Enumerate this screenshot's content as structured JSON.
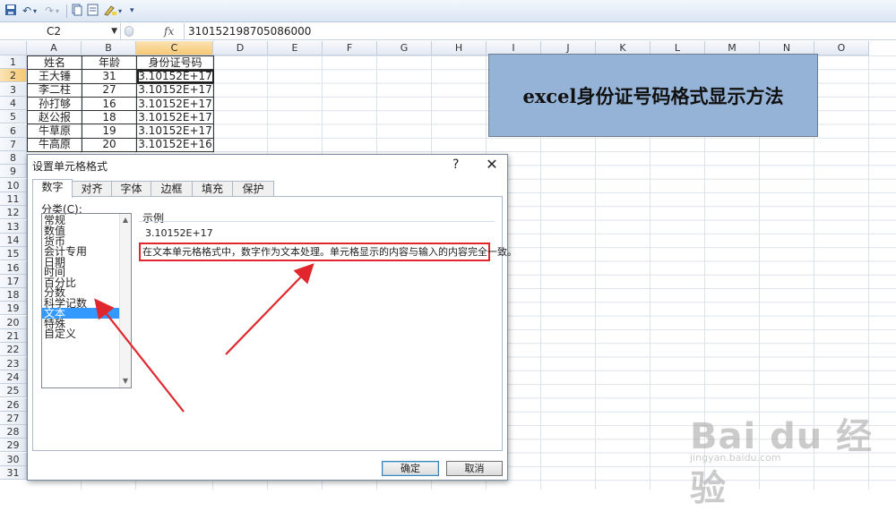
{
  "toolbar": {
    "items": [
      "save-icon",
      "undo-icon",
      "redo-icon",
      "copy-icon",
      "format-icon",
      "highlighter-icon",
      "customize-icon"
    ]
  },
  "formula_bar": {
    "name_box": "C2",
    "fx_label": "fx",
    "value": "310152198705086000"
  },
  "columns": [
    "A",
    "B",
    "C",
    "D",
    "E",
    "F",
    "G",
    "H",
    "I",
    "J",
    "K",
    "L",
    "M",
    "N",
    "O"
  ],
  "rows": [
    "1",
    "2",
    "3",
    "4",
    "5",
    "6",
    "7",
    "8",
    "9",
    "10",
    "11",
    "12",
    "13",
    "14",
    "15",
    "16",
    "17",
    "18",
    "19",
    "20",
    "21",
    "22",
    "23",
    "24",
    "25",
    "26",
    "27",
    "28",
    "29",
    "30",
    "31"
  ],
  "table": {
    "headers": [
      "姓名",
      "年龄",
      "身份证号码"
    ],
    "rows": [
      [
        "王大锤",
        "31",
        "3.10152E+17"
      ],
      [
        "李二柱",
        "27",
        "3.10152E+17"
      ],
      [
        "孙打够",
        "16",
        "3.10152E+17"
      ],
      [
        "赵公报",
        "18",
        "3.10152E+17"
      ],
      [
        "牛草原",
        "19",
        "3.10152E+17"
      ],
      [
        "牛高原",
        "20",
        "3.10152E+16"
      ]
    ]
  },
  "banner": {
    "text": "excel身份证号码格式显示方法",
    "color": "#95b3d7"
  },
  "dialog": {
    "title": "设置单元格格式",
    "help": "?",
    "close": "✕",
    "tabs": [
      "数字",
      "对齐",
      "字体",
      "边框",
      "填充",
      "保护"
    ],
    "active_tab": "数字",
    "category_label": "分类(C):",
    "categories": [
      "常规",
      "数值",
      "货币",
      "会计专用",
      "日期",
      "时间",
      "百分比",
      "分数",
      "科学记数",
      "文本",
      "特殊",
      "自定义"
    ],
    "selected_category": "文本",
    "sample_label": "示例",
    "sample_value": "3.10152E+17",
    "description": "在文本单元格格式中，数字作为文本处理。单元格显示的内容与输入的内容完全一致。",
    "ok_label": "确定",
    "cancel_label": "取消"
  },
  "annotation": {
    "highlight_color": "#e0272d"
  },
  "watermark": {
    "text": "Bai du 经验",
    "url": "jingyan.baidu.com"
  }
}
